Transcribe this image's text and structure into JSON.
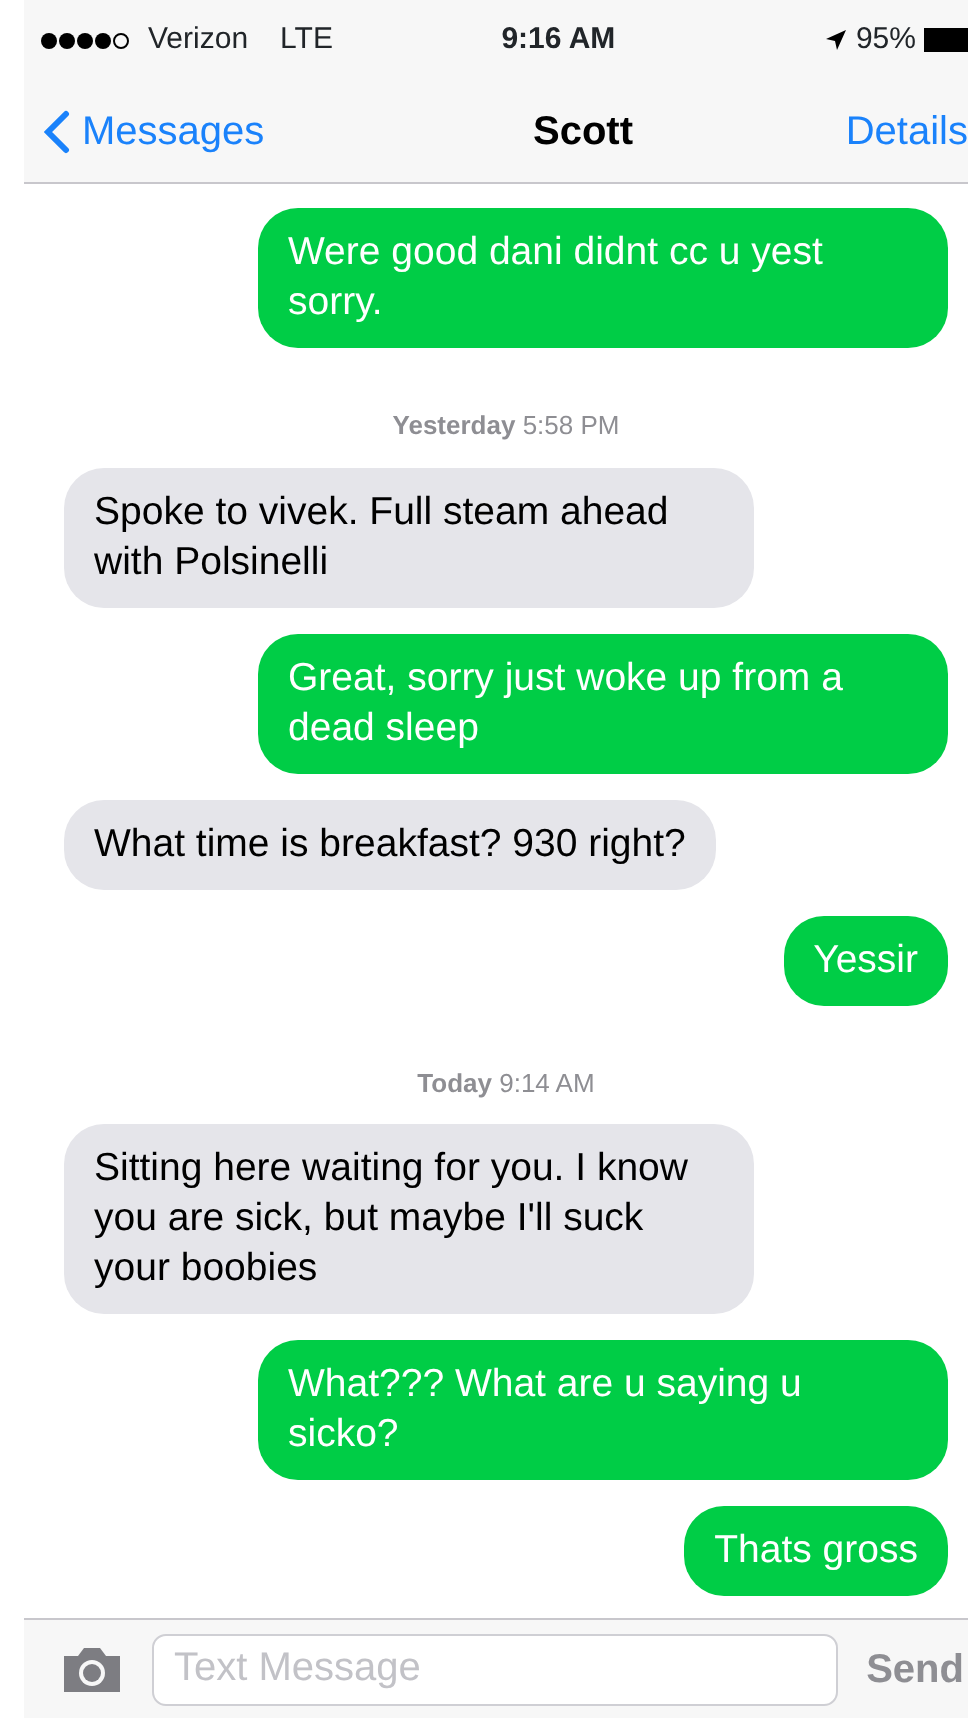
{
  "status_bar": {
    "carrier": "Verizon",
    "network": "LTE",
    "time": "9:16 AM",
    "battery": "95%"
  },
  "nav": {
    "back": "Messages",
    "title": "Scott",
    "action": "Details"
  },
  "messages": [
    {
      "kind": "sent",
      "text": "Were good dani didnt cc u yest sorry."
    },
    {
      "kind": "timestamp",
      "text": "**Yesterday** 5:58 PM"
    },
    {
      "kind": "received",
      "text": "Spoke to vivek.  Full steam ahead with Polsinelli"
    },
    {
      "kind": "sent",
      "text": "Great, sorry just woke up from a dead sleep"
    },
    {
      "kind": "received",
      "text": "What time is breakfast? 930 right?"
    },
    {
      "kind": "sent",
      "text": "Yessir"
    },
    {
      "kind": "timestamp",
      "text": "**Today** 9:14 AM"
    },
    {
      "kind": "received",
      "text": "Sitting here waiting for you.  I know you are sick, but maybe I'll suck your boobies"
    },
    {
      "kind": "sent",
      "text": "What??? What are u saying u sicko?"
    },
    {
      "kind": "sent",
      "text": "Thats gross"
    }
  ],
  "composer": {
    "placeholder": "Text Message",
    "send": "Send"
  }
}
